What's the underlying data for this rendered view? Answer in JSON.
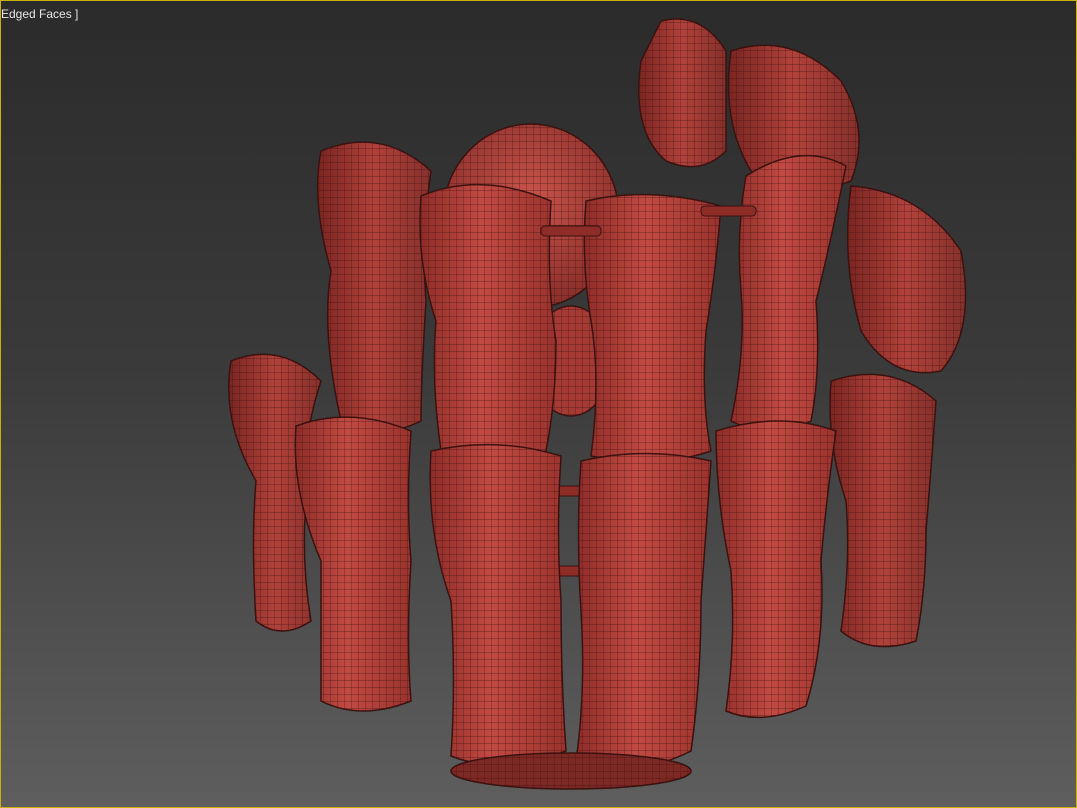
{
  "viewport": {
    "label": "Edged Faces ]",
    "border_color": "#c8b400",
    "background_top": "#2b2b2b",
    "background_bottom": "#5e5e5e"
  },
  "model": {
    "description_icon": "bracelet-mesh-model",
    "shading": "edged-faces",
    "surface_color": "#b8413b",
    "edge_color": "#3a1210"
  }
}
